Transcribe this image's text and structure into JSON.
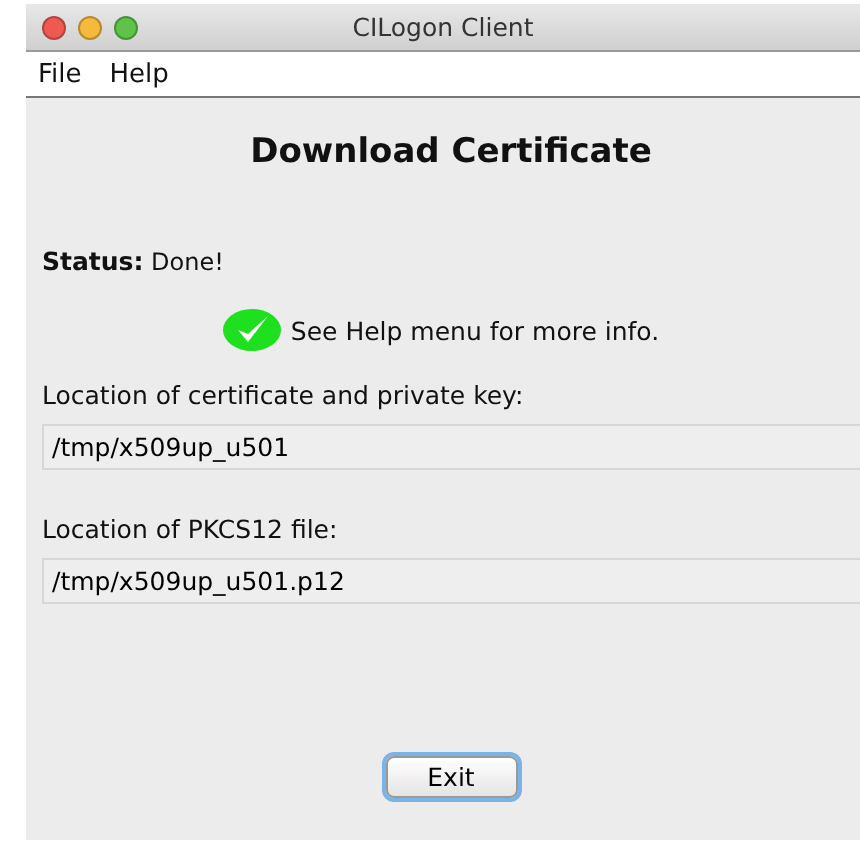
{
  "window": {
    "title": "CILogon Client"
  },
  "menu": [
    "File",
    "Help"
  ],
  "heading": "Download Certificate",
  "status": {
    "label": "Status:",
    "value": "Done!"
  },
  "message": {
    "kind": "success",
    "text": "See Help menu for more info."
  },
  "fields": [
    {
      "label": "Location of certificate and private key:",
      "value": "/tmp/x509up_u501"
    },
    {
      "label": "Location of PKCS12 file:",
      "value": "/tmp/x509up_u501.p12"
    }
  ],
  "buttons": [
    {
      "label": "Exit",
      "focused": true
    }
  ]
}
